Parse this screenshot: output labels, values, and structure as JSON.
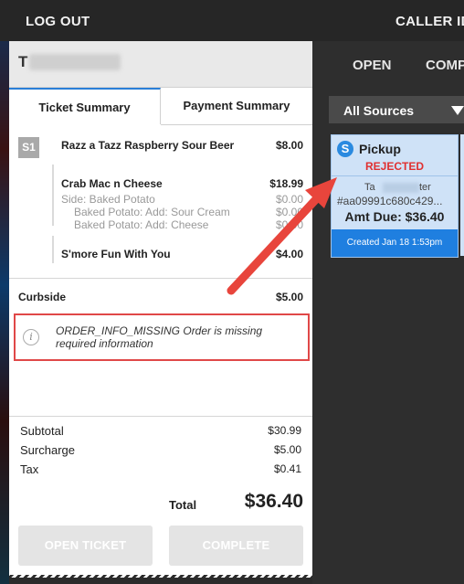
{
  "topbar": {
    "logout": "LOG OUT",
    "caller_id": "CALLER ID"
  },
  "customer": {
    "name": "T"
  },
  "tabs": {
    "ticket": "Ticket Summary",
    "payment": "Payment Summary"
  },
  "items": {
    "seat": "S1",
    "i1": {
      "name": "Razz a Tazz Raspberry Sour Beer",
      "price": "$8.00"
    },
    "i2": {
      "name": "Crab Mac n Cheese",
      "price": "$18.99",
      "mods": [
        {
          "name": "Side: Baked Potato",
          "price": "$0.00"
        },
        {
          "name": "Baked Potato: Add: Sour Cream",
          "price": "$0.00"
        },
        {
          "name": "Baked Potato: Add: Cheese",
          "price": "$0.00"
        }
      ]
    },
    "i3": {
      "name": "S'more Fun With You",
      "price": "$4.00"
    }
  },
  "curbside": {
    "label": "Curbside",
    "price": "$5.00"
  },
  "warning": {
    "text": "ORDER_INFO_MISSING Order is missing required information"
  },
  "totals": {
    "subtotal_label": "Subtotal",
    "subtotal": "$30.99",
    "surcharge_label": "Surcharge",
    "surcharge": "$5.00",
    "tax_label": "Tax",
    "tax": "$0.41",
    "total_label": "Total",
    "total": "$36.40"
  },
  "buttons": {
    "open": "OPEN TICKET",
    "complete": "COMPLETE"
  },
  "right": {
    "tab_open": "OPEN",
    "tab_comp": "COMP",
    "source": "All Sources",
    "card": {
      "type": "Pickup",
      "status": "REJECTED",
      "name_start": "Ta",
      "name_end": "ter",
      "id": "#aa09991c680c429...",
      "amount": "Amt Due: $36.40",
      "created": "Created Jan 18 1:53pm"
    }
  },
  "colors": {
    "accent": "#1f7fe0",
    "warning_border": "#e04848",
    "rejected": "#e03030",
    "arrow": "#e8453c"
  }
}
